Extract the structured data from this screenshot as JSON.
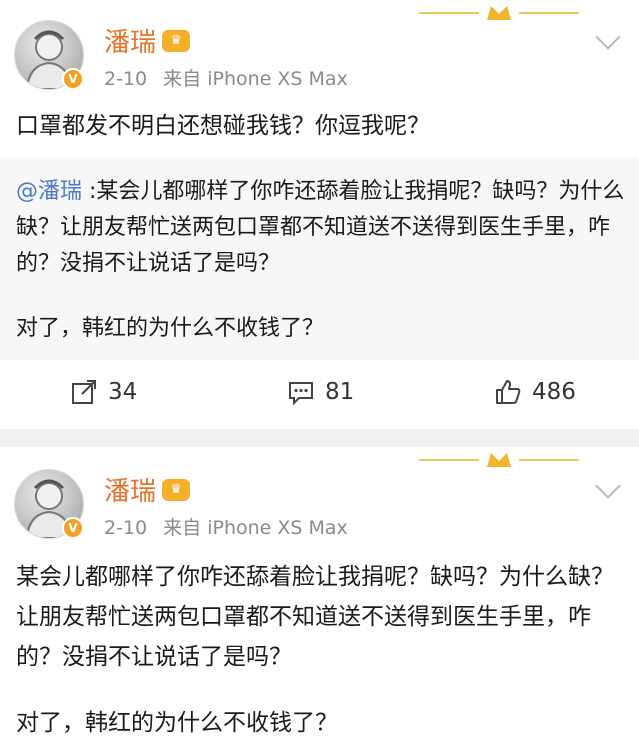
{
  "post1": {
    "author": "潘瑞",
    "badge": "V",
    "crown": "♛",
    "date": "2-10",
    "source": "来自 iPhone XS Max",
    "text": "口罩都发不明白还想碰我钱？你逗我呢？",
    "quote": {
      "mention": "@潘瑞",
      "body": " :某会儿都哪样了你咋还舔着脸让我捐呢？缺吗？为什么缺？让朋友帮忙送两包口罩都不知道送不送得到医生手里，咋的？没捐不让说话了是吗？",
      "para2": "对了，韩红的为什么不收钱了？"
    },
    "actions": {
      "repost": "34",
      "comment": "81",
      "like": "486"
    }
  },
  "post2": {
    "author": "潘瑞",
    "badge": "V",
    "crown": "♛",
    "date": "2-10",
    "source": "来自 iPhone XS Max",
    "text": "某会儿都哪样了你咋还舔着脸让我捐呢？缺吗？为什么缺？让朋友帮忙送两包口罩都不知道送不送得到医生手里，咋的？没捐不让说话了是吗？",
    "para2": "对了，韩红的为什么不收钱了？"
  },
  "colors": {
    "author": "#e8732a",
    "mention": "#4c78c7",
    "meta": "#8a8a8a",
    "badge": "#f4a023"
  }
}
